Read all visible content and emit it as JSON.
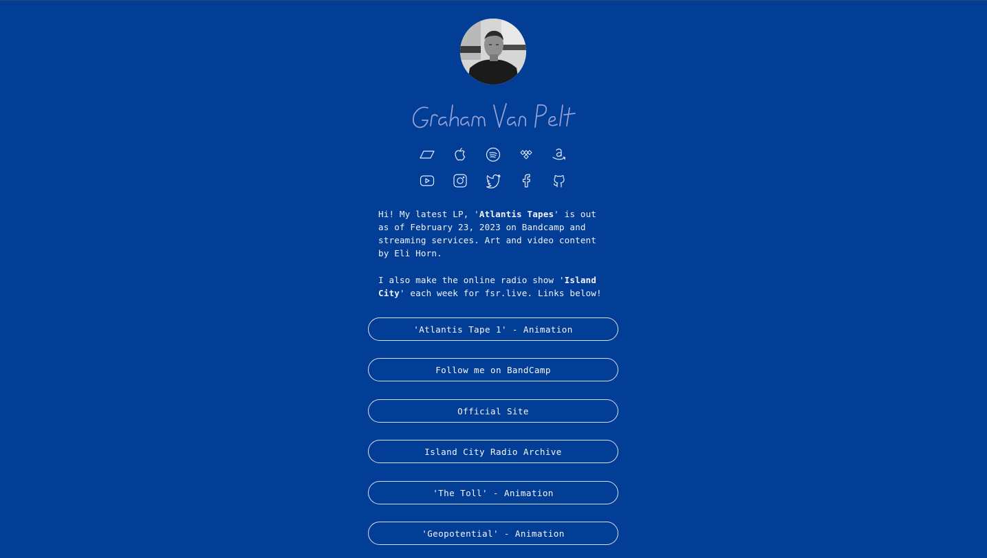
{
  "profile": {
    "name": "Graham Van Pelt"
  },
  "colors": {
    "background": "#033e96",
    "text": "#f1f3fb",
    "signature": "#9aa7dc",
    "button_border": "#dbe2f6"
  },
  "music_icons": [
    {
      "name": "bandcamp-icon"
    },
    {
      "name": "apple-music-icon"
    },
    {
      "name": "spotify-icon"
    },
    {
      "name": "tidal-icon"
    },
    {
      "name": "amazon-music-icon"
    }
  ],
  "social_icons": [
    {
      "name": "youtube-icon"
    },
    {
      "name": "instagram-icon"
    },
    {
      "name": "twitter-icon"
    },
    {
      "name": "facebook-icon"
    },
    {
      "name": "github-icon"
    }
  ],
  "bio": {
    "p1_before": "Hi! My latest LP, '",
    "p1_bold": "Atlantis Tapes",
    "p1_after": "' is out as of February 23, 2023 on Bandcamp and streaming services. Art and video content by Eli Horn.",
    "p2_before": "I also make the online radio show '",
    "p2_bold": "Island City",
    "p2_after": "' each week for fsr.live. Links below!"
  },
  "links": [
    {
      "label": "'Atlantis Tape 1' - Animation"
    },
    {
      "label": "Follow me on BandCamp"
    },
    {
      "label": "Official Site"
    },
    {
      "label": "Island City Radio Archive"
    },
    {
      "label": "'The Toll' - Animation"
    },
    {
      "label": "'Geopotential' - Animation"
    }
  ]
}
